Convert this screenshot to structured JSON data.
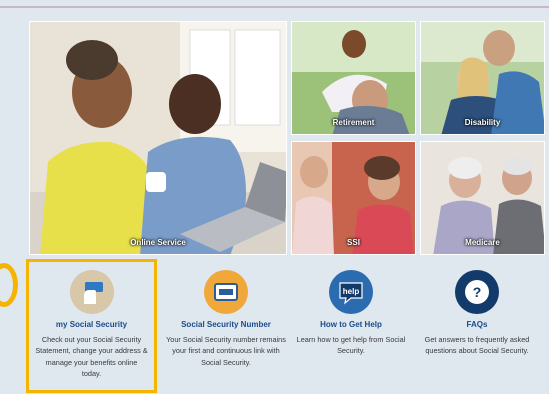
{
  "tiles": [
    {
      "caption": "Online Service"
    },
    {
      "caption": "Retirement"
    },
    {
      "caption": "Disability"
    },
    {
      "caption": "SSI"
    },
    {
      "caption": "Medicare"
    }
  ],
  "features": [
    {
      "title": "my Social Security",
      "description": "Check out your Social Security Statement, change your address & manage your benefits online today.",
      "icon": "hand-card-icon",
      "highlighted": true
    },
    {
      "title": "Social Security Number",
      "description": "Your Social Security number remains your first and continuous link with Social Security.",
      "icon": "ss-card-icon"
    },
    {
      "title": "How to Get Help",
      "description": "Learn how to get help from Social Security.",
      "icon": "help-bubble-icon",
      "icon_text": "help"
    },
    {
      "title": "FAQs",
      "description": "Get answers to frequently asked questions about Social Security.",
      "icon": "question-icon",
      "icon_text": "?"
    }
  ],
  "colors": {
    "background": "#dfe7ef",
    "link": "#1a4c8b",
    "highlight": "#f4b400",
    "icon_tan": "#d8c7a8",
    "icon_orange": "#f0a83a",
    "icon_blue": "#2b6cb0",
    "icon_navy": "#123a6b"
  }
}
